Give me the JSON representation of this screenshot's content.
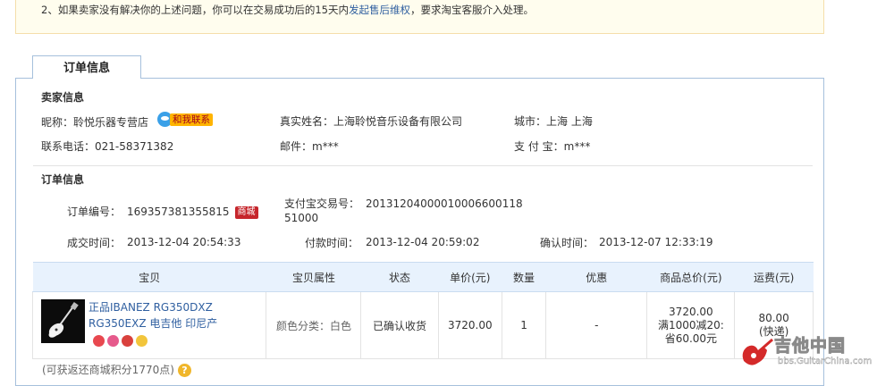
{
  "notice": {
    "prefix": "2、如果卖家没有解决你的上述问题，你可以在交易成功后的15天内",
    "link": "发起售后维权",
    "suffix": "，要求淘宝客服介入处理。"
  },
  "tab": {
    "label": "订单信息"
  },
  "seller": {
    "title": "卖家信息",
    "nickname_label": "昵称：",
    "nickname": "聆悦乐器专营店",
    "contact_label": "和我联系",
    "realname_label": "真实姓名：",
    "realname": "上海聆悦音乐设备有限公司",
    "city_label": "城市：",
    "city": "上海 上海",
    "phone_label": "联系电话：",
    "phone": "021-58371382",
    "email_label": "邮件：",
    "email": "m***",
    "alipay_label": "支 付 宝：",
    "alipay": "m***"
  },
  "order": {
    "title": "订单信息",
    "no_label": "订单编号：",
    "no": "169357381355815",
    "mall_badge": "商城",
    "alipay_no_label": "支付宝交易号：",
    "alipay_no_line1": "20131204000010006600118",
    "alipay_no_line2": "51000",
    "deal_time_label": "成交时间：",
    "deal_time": "2013-12-04 20:54:33",
    "pay_time_label": "付款时间：",
    "pay_time": "2013-12-04 20:59:02",
    "confirm_time_label": "确认时间：",
    "confirm_time": "2013-12-07 12:33:19"
  },
  "table": {
    "headers": [
      "宝贝",
      "宝贝属性",
      "状态",
      "单价(元)",
      "数量",
      "优惠",
      "商品总价(元)",
      "运费(元)"
    ],
    "row": {
      "name": "正品IBANEZ RG350DXZ RG350EXZ 电吉他 印尼产",
      "attr": "颜色分类：白色",
      "status": "已确认收货",
      "price": "3720.00",
      "qty": "1",
      "discount": "-",
      "total_line1": "3720.00",
      "total_line2": "满1000减20:",
      "total_line3": "省60.00元",
      "shipping": "80.00",
      "shipping_type": "(快递)"
    }
  },
  "points": {
    "text": "(可获返还商城积分1770点)"
  },
  "watermark": {
    "title": "吉他中国",
    "url": "bbs.GuitarChina.com"
  },
  "colors": {
    "link": "#2f5fa0",
    "badge": "#c6262c",
    "header_bg": "#e8f2fd",
    "notice_bg": "#fffdee"
  }
}
